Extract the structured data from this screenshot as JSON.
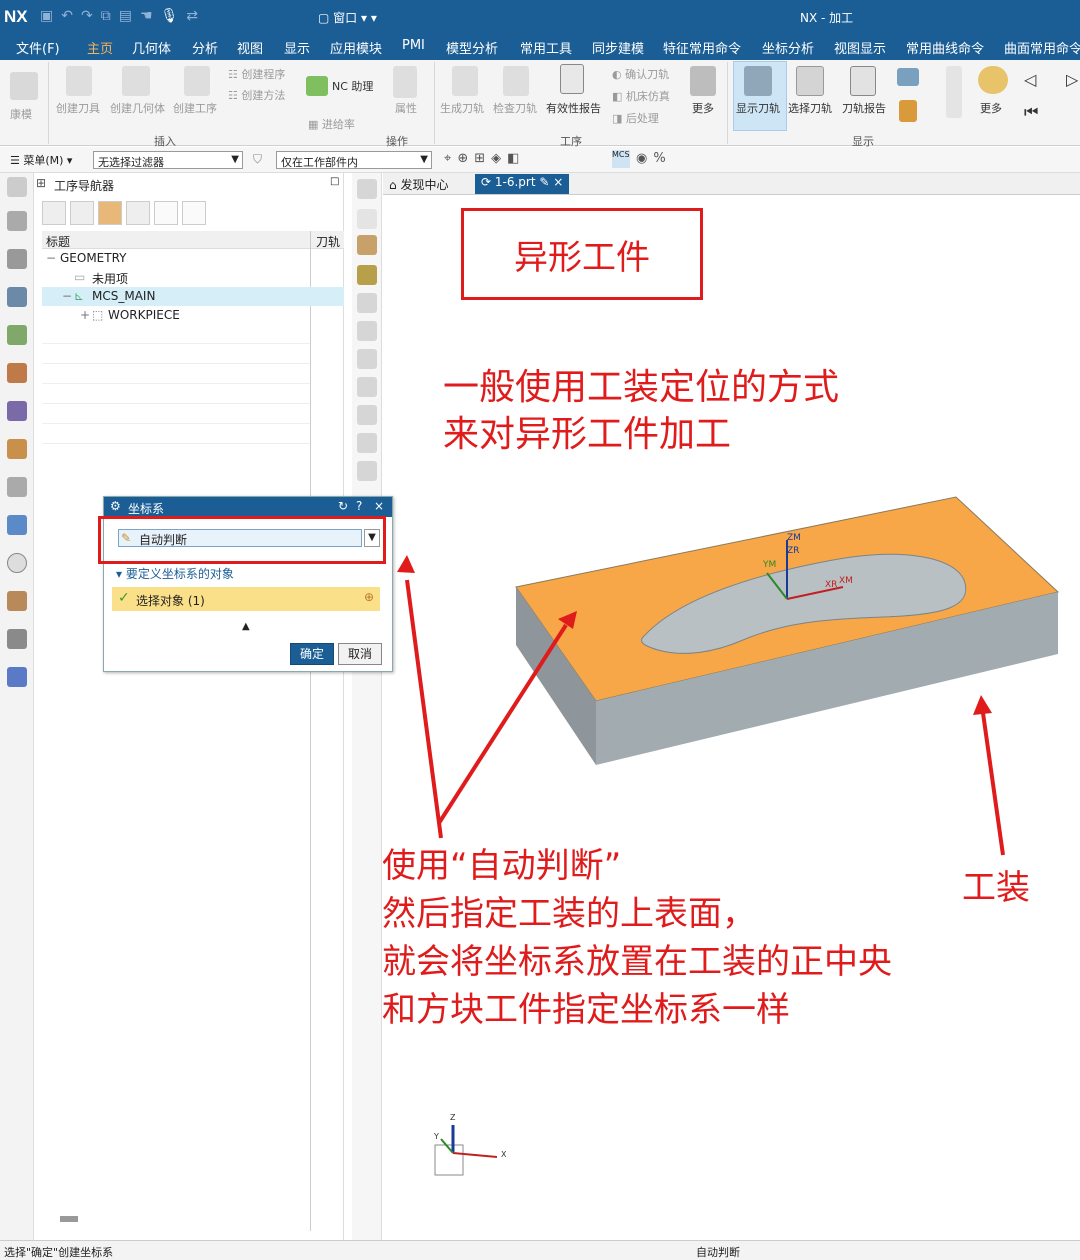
{
  "titlebar": {
    "logo": "NX",
    "window_menu": "窗口",
    "title": "NX - 加工"
  },
  "menubar": {
    "tabs": [
      "文件(F)",
      "主页",
      "几何体",
      "分析",
      "视图",
      "显示",
      "应用模块",
      "PMI",
      "模型分析",
      "常用工具",
      "同步建模",
      "特征常用命令",
      "坐标分析",
      "视图显示",
      "常用曲线命令",
      "曲面常用命令"
    ],
    "active": "主页"
  },
  "ribbon": {
    "buttons": {
      "kuomo": "康模",
      "create_tool": "创建刀具",
      "create_geometry": "创建几何体",
      "create_operation": "创建工序",
      "create_program": "创建程序",
      "create_method": "创建方法",
      "nc_assistant": "NC 助理",
      "tool_info": "进给率",
      "attribute": "属性",
      "generate_path": "生成刀轨",
      "verify_path": "检查刀轨",
      "validity_report": "有效性报告",
      "confirm_path": "确认刀轨",
      "machine_sim": "机床仿真",
      "post_process": "后处理",
      "more1": "更多",
      "show_path": "显示刀轨",
      "select_path": "选择刀轨",
      "path_report": "刀轨报告",
      "more2": "更多"
    },
    "groups": {
      "insert": "插入",
      "operation": "操作",
      "process": "工序",
      "display": "显示"
    }
  },
  "filterbar": {
    "menu": "菜单(M)",
    "filter": "无选择过滤器",
    "scope": "仅在工作部件内"
  },
  "navigator": {
    "title": "工序导航器",
    "col_title": "标题",
    "col_tool": "刀轨",
    "rows": [
      "GEOMETRY",
      "未用项",
      "MCS_MAIN",
      "WORKPIECE"
    ]
  },
  "graphics_tabs": {
    "discovery": "发现中心",
    "part": "1-6.prt"
  },
  "dialog": {
    "title": "坐标系",
    "help": "?",
    "close": "×",
    "type_value": "自动判断",
    "section": "要定义坐标系的对象",
    "select": "选择对象 (1)",
    "ok": "确定",
    "cancel": "取消"
  },
  "annotations": {
    "title_box": "异形工件",
    "line1": "一般使用工装定位的方式",
    "line2": "来对异形工件加工",
    "usage_lines": [
      "使用“自动判断”",
      "然后指定工装的上表面，",
      "就会将坐标系放置在工装的正中央",
      "和方块工件指定坐标系一样"
    ],
    "fixture": "工装"
  },
  "axes": {
    "zm": "ZM",
    "zr": "ZR",
    "ym": "YM",
    "xm": "XM",
    "xr": "XR",
    "triad_z": "Z",
    "triad_y": "Y",
    "triad_x": "X"
  },
  "status": {
    "left": "选择\"确定\"创建坐标系",
    "center": "自动判断"
  },
  "colors": {
    "nx_blue": "#1b5e96",
    "accent_orange": "#f6b35b",
    "annotation_red": "#e01b1b",
    "part_top": "#f7a748",
    "part_side": "#9aa3a8"
  }
}
